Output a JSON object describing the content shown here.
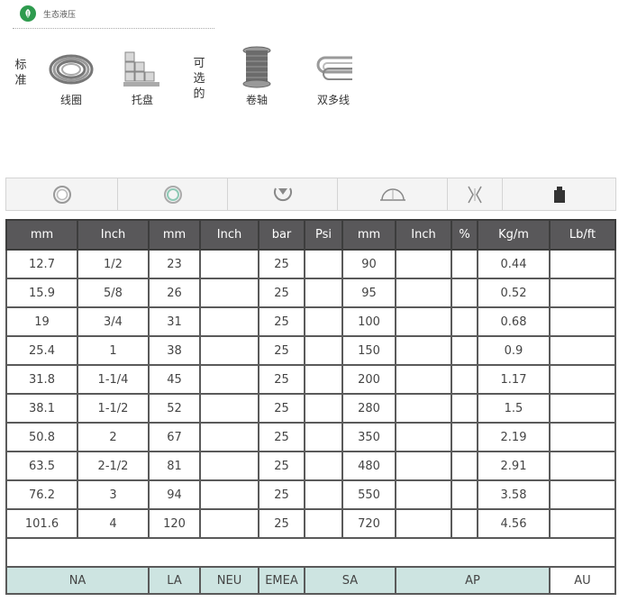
{
  "brand": {
    "name": "生态液压",
    "icon": "leaf-icon",
    "color": "#2e9b4e"
  },
  "packaging": {
    "standard_label": [
      "标",
      "准"
    ],
    "optional_label": [
      "可",
      "选",
      "的"
    ],
    "standard": [
      {
        "label": "线圈",
        "icon": "hose-coil-icon"
      },
      {
        "label": "托盘",
        "icon": "pallet-icon"
      }
    ],
    "optional": [
      {
        "label": "卷轴",
        "icon": "reel-icon"
      },
      {
        "label": "双多线",
        "icon": "twin-line-icon"
      }
    ]
  },
  "icon_strip": [
    "inner-diameter-icon",
    "outer-diameter-icon",
    "working-pressure-icon",
    "bend-radius-icon",
    "vacuum-icon",
    "weight-icon"
  ],
  "table": {
    "headers": [
      "mm",
      "Inch",
      "mm",
      "Inch",
      "bar",
      "Psi",
      "mm",
      "Inch",
      "%",
      "Kg/m",
      "Lb/ft"
    ],
    "rows": [
      [
        "12.7",
        "1/2",
        "23",
        "",
        "25",
        "",
        "90",
        "",
        "",
        "0.44",
        ""
      ],
      [
        "15.9",
        "5/8",
        "26",
        "",
        "25",
        "",
        "95",
        "",
        "",
        "0.52",
        ""
      ],
      [
        "19",
        "3/4",
        "31",
        "",
        "25",
        "",
        "100",
        "",
        "",
        "0.68",
        ""
      ],
      [
        "25.4",
        "1",
        "38",
        "",
        "25",
        "",
        "150",
        "",
        "",
        "0.9",
        ""
      ],
      [
        "31.8",
        "1-1/4",
        "45",
        "",
        "25",
        "",
        "200",
        "",
        "",
        "1.17",
        ""
      ],
      [
        "38.1",
        "1-1/2",
        "52",
        "",
        "25",
        "",
        "280",
        "",
        "",
        "1.5",
        ""
      ],
      [
        "50.8",
        "2",
        "67",
        "",
        "25",
        "",
        "350",
        "",
        "",
        "2.19",
        ""
      ],
      [
        "63.5",
        "2-1/2",
        "81",
        "",
        "25",
        "",
        "480",
        "",
        "",
        "2.91",
        ""
      ],
      [
        "76.2",
        "3",
        "94",
        "",
        "25",
        "",
        "550",
        "",
        "",
        "3.58",
        ""
      ],
      [
        "101.6",
        "4",
        "120",
        "",
        "25",
        "",
        "720",
        "",
        "",
        "4.56",
        ""
      ]
    ],
    "regions": [
      {
        "label": "NA",
        "highlight": true
      },
      {
        "label": "LA",
        "highlight": true
      },
      {
        "label": "NEU",
        "highlight": true
      },
      {
        "label": "EMEA",
        "highlight": true
      },
      {
        "label": "SA",
        "highlight": true
      },
      {
        "label": "AP",
        "highlight": true
      },
      {
        "label": "AU",
        "highlight": false
      }
    ],
    "colors": {
      "header_bg": "#59585a",
      "region_bg": "#cde4e1"
    }
  }
}
